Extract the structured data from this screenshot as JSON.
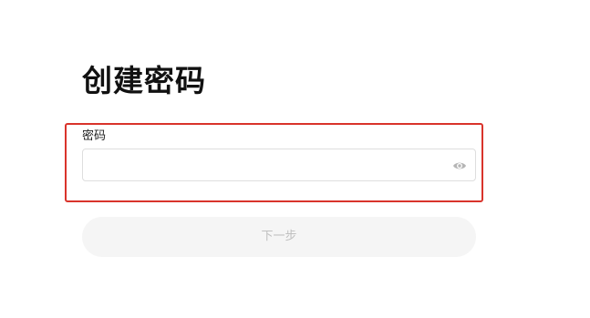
{
  "page": {
    "title": "创建密码"
  },
  "form": {
    "password_label": "密码",
    "password_value": "",
    "password_placeholder": "",
    "visibility_icon": "eye-icon"
  },
  "actions": {
    "next_label": "下一步"
  },
  "colors": {
    "highlight_border": "#d9332b",
    "button_background": "#f5f5f5",
    "button_text": "#c0c0c0"
  }
}
